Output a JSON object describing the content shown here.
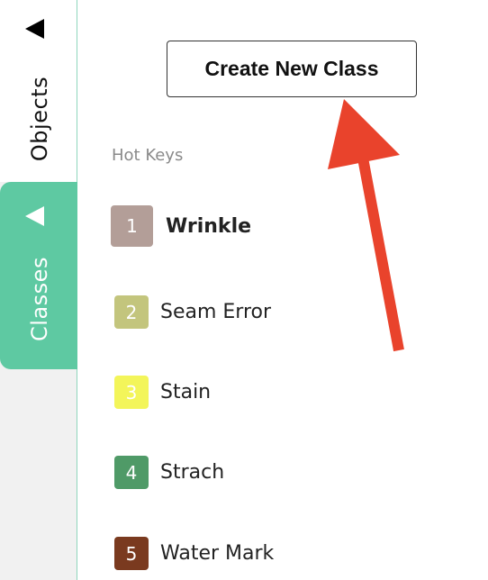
{
  "sidebar": {
    "tabs": [
      {
        "label": "Objects"
      },
      {
        "label": "Classes"
      }
    ]
  },
  "panel": {
    "create_button_label": "Create New Class",
    "hotkeys_label": "Hot Keys",
    "classes": [
      {
        "key": "1",
        "name": "Wrinkle",
        "color": "#b39e98"
      },
      {
        "key": "2",
        "name": "Seam Error",
        "color": "#c3c57d"
      },
      {
        "key": "3",
        "name": "Stain",
        "color": "#f3f55a"
      },
      {
        "key": "4",
        "name": "Strach",
        "color": "#4f9a67"
      },
      {
        "key": "5",
        "name": "Water Mark",
        "color": "#7a3a1f"
      }
    ]
  },
  "colors": {
    "accent": "#5ec9a2",
    "annotation_arrow": "#e9432c"
  }
}
